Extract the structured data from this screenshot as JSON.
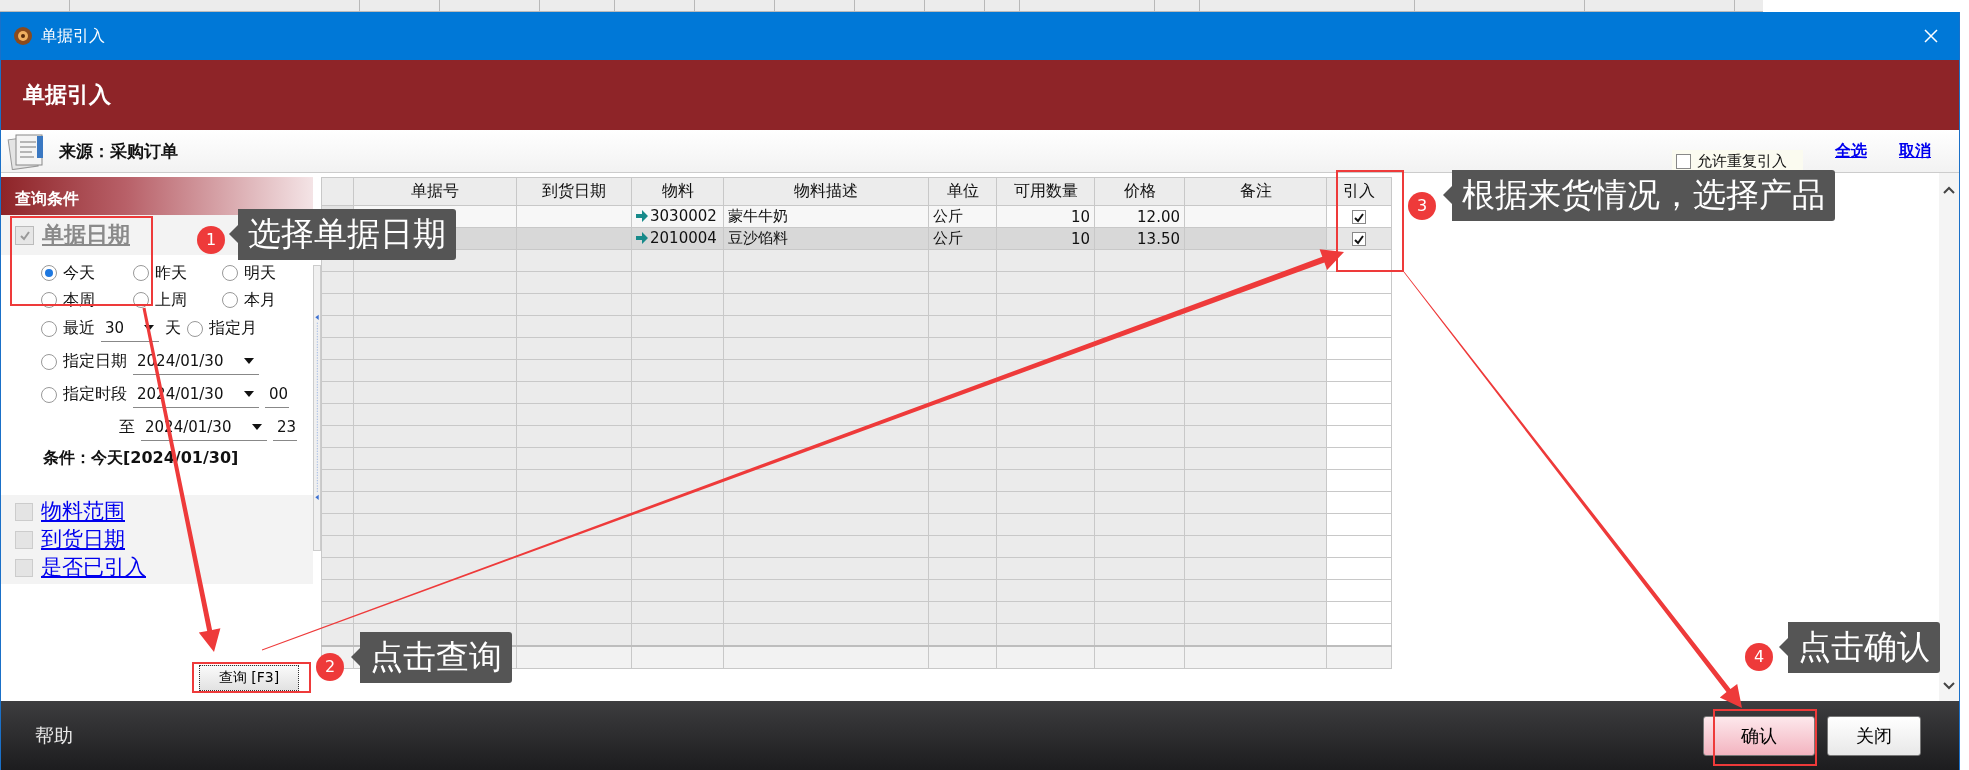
{
  "window": {
    "title": "单据引入"
  },
  "banner": {
    "title": "单据引入"
  },
  "source": {
    "label": "来源：采购订单"
  },
  "allow_duplicate": {
    "label": "允许重复引入",
    "checked": false
  },
  "links": [
    "全选",
    "取消"
  ],
  "query_panel": {
    "title": "查询条件",
    "date_filter": {
      "label": "单据日期",
      "checked": true,
      "disabled": true
    },
    "date_options": [
      {
        "label": "今天",
        "selected": true
      },
      {
        "label": "昨天",
        "selected": false
      },
      {
        "label": "明天",
        "selected": false
      },
      {
        "label": "本周",
        "selected": false
      },
      {
        "label": "上周",
        "selected": false
      },
      {
        "label": "本月",
        "selected": false
      }
    ],
    "recent": {
      "label": "最近",
      "value": "30",
      "unit": "天",
      "selected": false
    },
    "month": {
      "label": "指定月",
      "selected": false
    },
    "specific_date": {
      "label": "指定日期",
      "value": "2024/01/30",
      "selected": false
    },
    "period": {
      "label": "指定时段",
      "from_date": "2024/01/30",
      "from_hour": "00",
      "to_label": "至",
      "to_date": "2024/01/30",
      "to_hour": "23",
      "selected": false
    },
    "condition": "条件：今天[2024/01/30]",
    "filters": [
      {
        "label": "物料范围",
        "checked": false
      },
      {
        "label": "到货日期",
        "checked": false
      },
      {
        "label": "是否已引入",
        "checked": false
      }
    ],
    "query_button": "查询 [F3]"
  },
  "table": {
    "columns": [
      "单据号",
      "到货日期",
      "物料",
      "物料描述",
      "单位",
      "可用数量",
      "价格",
      "备注",
      "引入"
    ],
    "rows": [
      {
        "material": "3030002",
        "description": "蒙牛牛奶",
        "unit": "公斤",
        "available_qty": "10",
        "price": "12.00",
        "import": true,
        "selected": false
      },
      {
        "material": "2010004",
        "description": "豆沙馅料",
        "unit": "公斤",
        "available_qty": "10",
        "price": "13.50",
        "import": true,
        "selected": true
      }
    ]
  },
  "footer": {
    "help": "帮助",
    "buttons": [
      "确认",
      "关闭"
    ]
  },
  "annotations": [
    {
      "number": "1",
      "text": "选择单据日期"
    },
    {
      "number": "2",
      "text": "点击查询"
    },
    {
      "number": "3",
      "text": "根据来货情况，选择产品"
    },
    {
      "number": "4",
      "text": "点击确认"
    }
  ]
}
